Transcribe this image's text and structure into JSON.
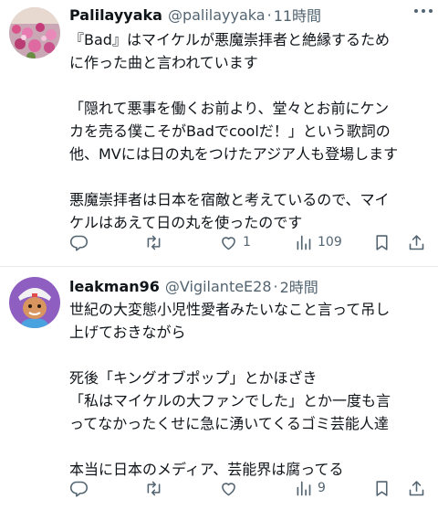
{
  "tweets": [
    {
      "display_name": "Palilayyaka",
      "handle": "@palilayyaka",
      "separator": "·",
      "time": "11時間",
      "lines": [
        "『Bad』はマイケルが悪魔崇拝者と絶縁するため",
        "に作った曲と言われています",
        "",
        "「隠れて悪事を働くお前より、堂々とお前にケン",
        "カを売る僕こそがBadでcoolだ！」という歌詞の",
        "他、MVには日の丸をつけたアジア人も登場します",
        "",
        "悪魔崇拝者は日本を宿敵と考えているので、マイ",
        "ケルはあえて日の丸を使ったのです"
      ],
      "counts": {
        "reply": "",
        "retweet": "",
        "like": "1",
        "views": "109"
      }
    },
    {
      "display_name": "leakman96",
      "handle": "@VigilanteE28",
      "separator": "·",
      "time": "2時間",
      "lines": [
        "世紀の大変態小児性愛者みたいなこと言って吊し",
        "上げておきながら",
        "",
        "死後「キングオブポップ」とかほざき",
        "「私はマイケルの大ファンでした」とか一度も言",
        "ってなかったくせに急に湧いてくるゴミ芸能人達",
        "",
        "本当に日本のメディア、芸能界は腐ってる"
      ],
      "counts": {
        "reply": "",
        "retweet": "",
        "like": "9",
        "views": ""
      }
    }
  ],
  "icons": [
    "reply-icon",
    "retweet-icon",
    "like-icon",
    "views-icon",
    "bookmark-icon",
    "share-icon",
    "more-icon"
  ],
  "colors": {
    "text": "#0f1419",
    "secondary": "#536471",
    "divider": "#e7e9ec"
  }
}
